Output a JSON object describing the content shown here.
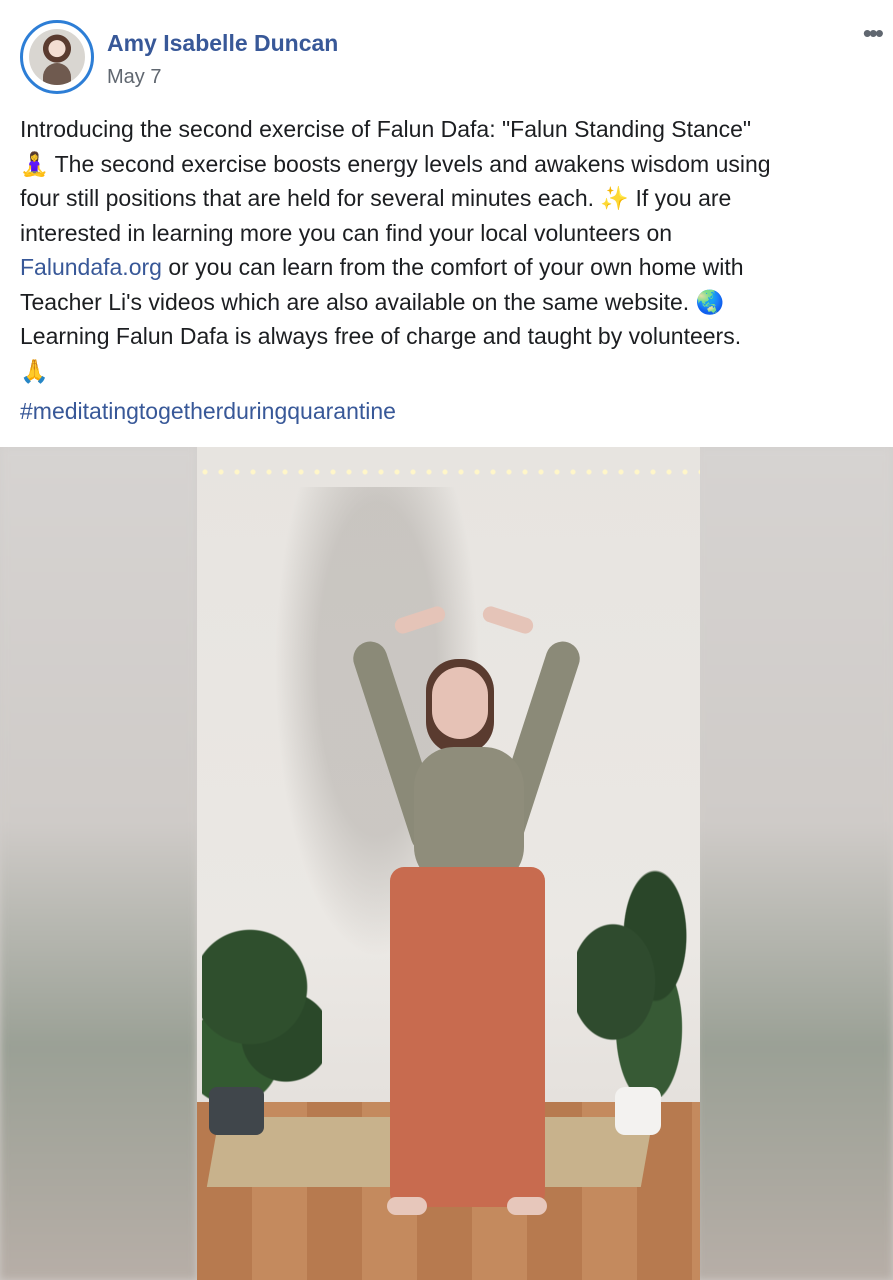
{
  "post": {
    "author_name": "Amy Isabelle Duncan",
    "date": "May 7",
    "more_menu": "•••",
    "text_lines": [
      {
        "pre": "Introducing the second exercise of Falun Dafa: \"Falun Standing Stance\""
      },
      {
        "emoji": "🧘‍♀️",
        "text": "The second exercise boosts energy levels and awakens wisdom using"
      },
      {
        "text": "four still positions that are held for several minutes each.",
        "emoji2": "✨",
        "after": "If you are"
      },
      {
        "text": "interested in learning more you can find your local volunteers on"
      },
      {
        "link": "Falundafa.org",
        "text": "or you can learn from the comfort of your own home with"
      },
      {
        "text": "Teacher Li's videos which are also available on the same website.",
        "emoji": "🌏"
      },
      {
        "text": "Learning Falun Dafa is always free of charge and taught by volunteers."
      },
      {
        "emoji": "🙏"
      }
    ],
    "hashtag": "#meditatingtogetherduringquarantine"
  },
  "icons": {
    "avatar": "avatar",
    "more": "more-options-icon"
  }
}
